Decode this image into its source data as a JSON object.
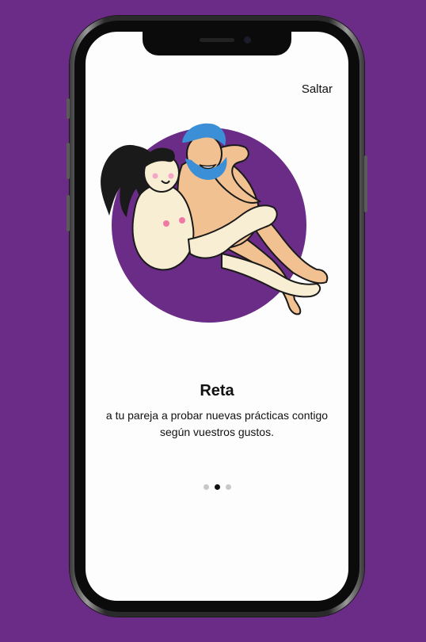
{
  "onboarding": {
    "skip_label": "Saltar",
    "title": "Reta",
    "description": "a tu pareja a probar nuevas prácticas contigo según vuestros gustos.",
    "pagination": {
      "total": 3,
      "active_index": 1
    }
  },
  "colors": {
    "background": "#6b2c87",
    "accent_circle": "#6b2c87",
    "screen": "#fdfdfd"
  }
}
